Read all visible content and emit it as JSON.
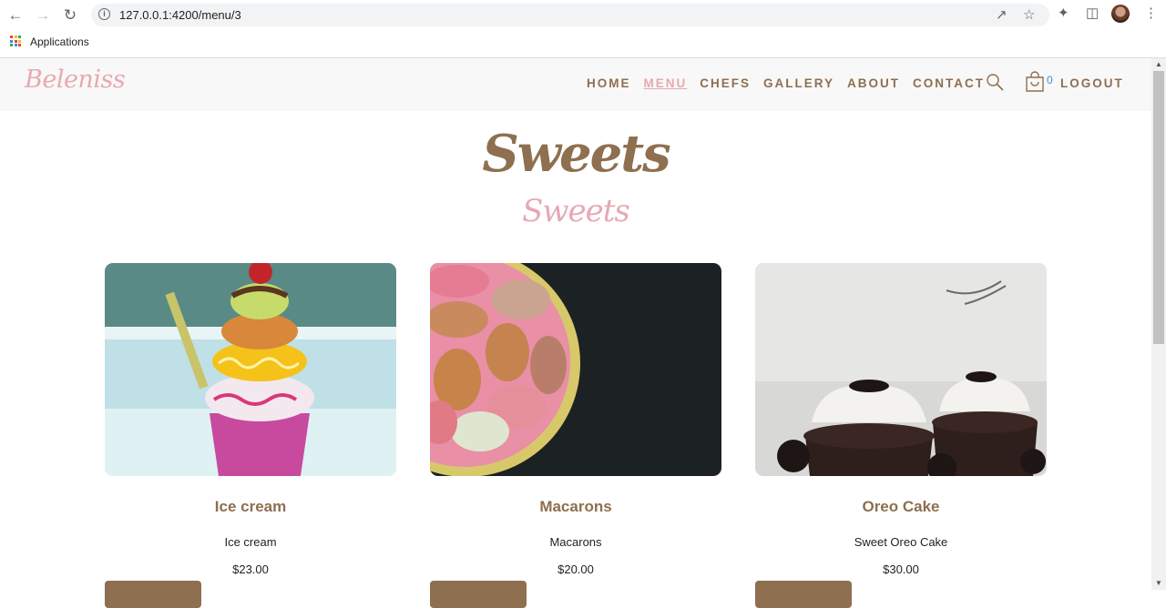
{
  "browser": {
    "url": "127.0.0.1:4200/menu/3",
    "bookmarks": [
      {
        "label": "Applications"
      }
    ]
  },
  "site": {
    "logo": "Beleniss",
    "nav": [
      {
        "label": "HOME",
        "active": false
      },
      {
        "label": "MENU",
        "active": true
      },
      {
        "label": "CHEFS",
        "active": false
      },
      {
        "label": "GALLERY",
        "active": false
      },
      {
        "label": "ABOUT",
        "active": false
      },
      {
        "label": "CONTACT",
        "active": false
      }
    ],
    "cart_count": "0",
    "logout": "LOGOUT"
  },
  "page": {
    "title": "Sweets",
    "subtitle": "Sweets"
  },
  "products": [
    {
      "name": "Ice cream",
      "description": "Ice cream",
      "price": "$23.00"
    },
    {
      "name": "Macarons",
      "description": "Macarons",
      "price": "$20.00"
    },
    {
      "name": "Oreo Cake",
      "description": "Sweet Oreo Cake",
      "price": "$30.00"
    }
  ],
  "colors": {
    "brand_brown": "#8e6f4f",
    "brand_pink": "#e7a9b2",
    "cart_count_blue": "#3b8fd6"
  }
}
